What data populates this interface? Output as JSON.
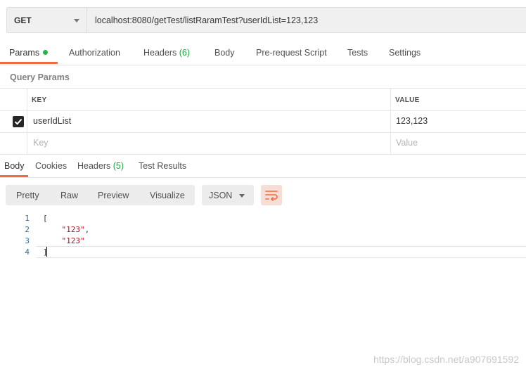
{
  "request": {
    "method": "GET",
    "url": "localhost:8080/getTest/listRaramTest?userIdList=123,123"
  },
  "request_tabs": {
    "params": "Params",
    "authorization": "Authorization",
    "headers": "Headers",
    "headers_count": "(6)",
    "body": "Body",
    "pre_request": "Pre-request Script",
    "tests": "Tests",
    "settings": "Settings"
  },
  "query_params": {
    "title": "Query Params",
    "header_key": "KEY",
    "header_value": "VALUE",
    "row_key": "userIdList",
    "row_value": "123,123",
    "key_placeholder": "Key",
    "value_placeholder": "Value"
  },
  "response_tabs": {
    "body": "Body",
    "cookies": "Cookies",
    "headers": "Headers",
    "headers_count": "(5)",
    "test_results": "Test Results"
  },
  "response_toolbar": {
    "pretty": "Pretty",
    "raw": "Raw",
    "preview": "Preview",
    "visualize": "Visualize",
    "format": "JSON"
  },
  "code": {
    "line_numbers": [
      "1",
      "2",
      "3",
      "4"
    ],
    "line1": "[",
    "line2_str": "\"123\"",
    "line2_punct": ",",
    "line3_str": "\"123\"",
    "line4": "]"
  },
  "watermark": "https://blog.csdn.net/a907691592",
  "colors": {
    "accent": "#f26b3a",
    "green": "#26a642"
  }
}
